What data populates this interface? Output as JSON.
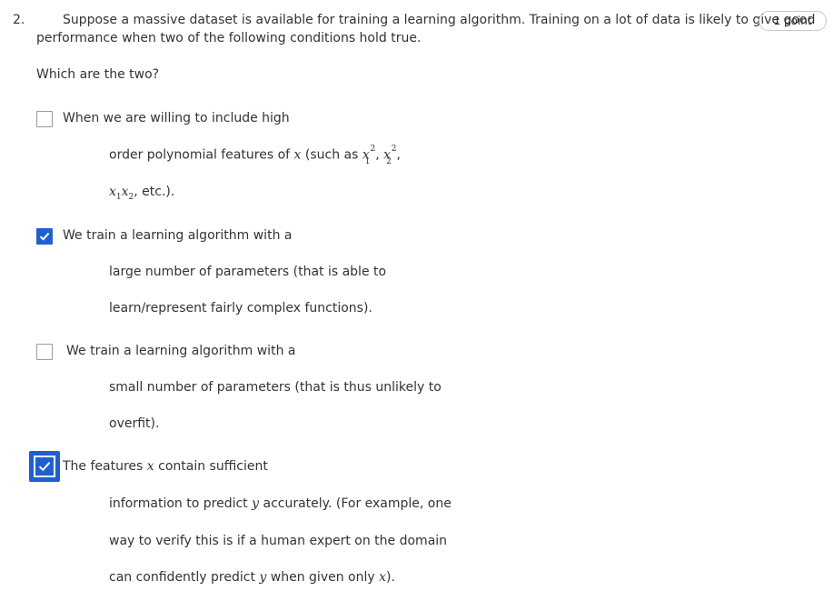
{
  "question": {
    "number": "2.",
    "text_line1": "Suppose a massive dataset is available for training a learning algorithm. Training on a lot of data is likely to give good",
    "text_line2": "performance when two of the following conditions hold true.",
    "prompt": "Which are the two?",
    "points": "1 point"
  },
  "options": [
    {
      "checked": false,
      "line1": "When we are willing to include high",
      "line2_pre": "order polynomial features of ",
      "line2_x": "x",
      "line2_mid": " (such as ",
      "line2_x1": "x",
      "line2_sub1": "1",
      "line2_sup1": "2",
      "line2_sep": ", ",
      "line2_x2": "x",
      "line2_sub2": "2",
      "line2_sup2": "2",
      "line2_end": ",",
      "line3_a": "x",
      "line3_sub_a": "1",
      "line3_b": "x",
      "line3_sub_b": "2",
      "line3_end": ", etc.)."
    },
    {
      "checked": true,
      "line1": "We train a learning algorithm with a",
      "line2": "large number of parameters (that is able to",
      "line3": "learn/represent fairly complex functions)."
    },
    {
      "checked": false,
      "line1": "We train a learning algorithm with a",
      "line2": "small number of parameters (that is thus unlikely to",
      "line3": "overfit)."
    },
    {
      "checked": true,
      "focused": true,
      "line1_pre": "The features ",
      "line1_x": "x",
      "line1_post": " contain sufficient",
      "line2_pre": "information to predict ",
      "line2_y": "y",
      "line2_post": " accurately.  (For example, one",
      "line3": "way to verify this is if a human expert on the domain",
      "line4_pre": "can confidently predict ",
      "line4_y": "y",
      "line4_mid": " when given only ",
      "line4_x": "x",
      "line4_end": ")."
    }
  ],
  "colors": {
    "checkbox_checked": "#1f5fd0",
    "checkbox_border": "#9b9b9b",
    "text": "#333333"
  },
  "icons": {
    "checkmark": "check-icon"
  }
}
